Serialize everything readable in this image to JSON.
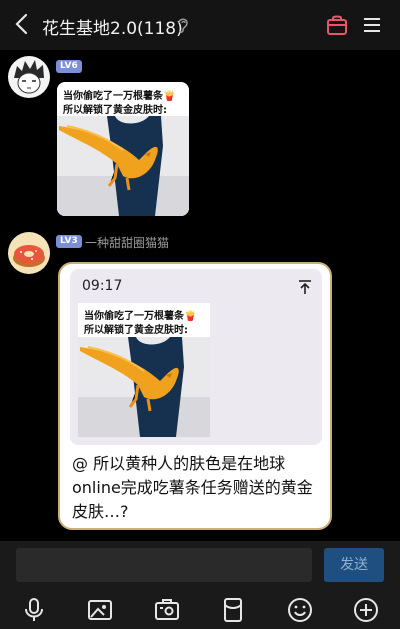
{
  "header": {
    "title": "花生基地2.0(118)",
    "icons": [
      "back-arrow-icon",
      "ear-icon",
      "shop-bag-icon",
      "menu-icon"
    ]
  },
  "messages": [
    {
      "avatar": "anime-boy-avatar",
      "level": "LV6",
      "level_color": "#7a8fd6",
      "nickname": "",
      "meme_caption_1": "当你偷吃了一万根薯条🍟",
      "meme_caption_2": "所以解锁了黄金皮肤时:"
    },
    {
      "avatar": "donut-avatar",
      "level": "LV3",
      "level_color": "#7a8fd6",
      "nickname": "一种甜甜圈猫猫",
      "quote_time": "09:17",
      "quote_caption_1": "当你偷吃了一万根薯条🍟",
      "quote_caption_2": "所以解锁了黄金皮肤时:",
      "text": "@ 所以黄种人的肤色是在地球online完成吃薯条任务赠送的黄金皮肤…?"
    }
  ],
  "input": {
    "placeholder": "",
    "send_label": "发送"
  },
  "toolbar": [
    "mic-icon",
    "image-icon",
    "camera-icon",
    "red-packet-icon",
    "emoji-icon",
    "plus-icon"
  ],
  "colors": {
    "accent_red": "#e8566a",
    "send_bg": "#1f4f80",
    "bird": "#f0a21e",
    "scrub": "#16304f"
  }
}
